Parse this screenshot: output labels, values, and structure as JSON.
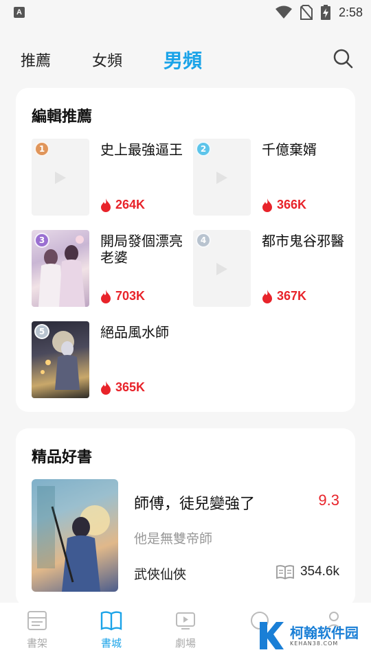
{
  "status_bar": {
    "time": "2:58",
    "notification_icon_letter": "A"
  },
  "tabs": [
    {
      "label": "推薦",
      "active": false
    },
    {
      "label": "女頻",
      "active": false
    },
    {
      "label": "男頻",
      "active": true
    }
  ],
  "editor_section": {
    "title": "編輯推薦",
    "items": [
      {
        "rank": "1",
        "title": "史上最強逼王",
        "heat": "264K",
        "medal_color": "#e0955a"
      },
      {
        "rank": "2",
        "title": "千億棄婿",
        "heat": "366K",
        "medal_color": "#5cc4ea"
      },
      {
        "rank": "3",
        "title": "開局發個漂亮老婆",
        "heat": "703K",
        "medal_color": "#9a6fd1"
      },
      {
        "rank": "4",
        "title": "都市鬼谷邪醫",
        "heat": "367K",
        "medal_color": "#b8c3cf"
      },
      {
        "rank": "5",
        "title": "絕品風水師",
        "heat": "365K",
        "medal_color": "#b8c3cf"
      }
    ]
  },
  "premium_section": {
    "title": "精品好書",
    "book": {
      "title": "師傅，徒兒變強了",
      "score": "9.3",
      "description": "他是無雙帝師",
      "genre": "武俠仙俠",
      "reads": "354.6k"
    }
  },
  "bottom_nav": [
    {
      "label": "書架",
      "icon": "bookshelf-icon",
      "active": false
    },
    {
      "label": "書城",
      "icon": "open-book-icon",
      "active": true
    },
    {
      "label": "劇場",
      "icon": "video-play-icon",
      "active": false
    },
    {
      "label": "",
      "icon": "circle-icon",
      "active": false
    },
    {
      "label": "",
      "icon": "user-icon",
      "active": false
    }
  ],
  "watermark": {
    "main": "柯翰软件园",
    "sub": "KEHAN38.COM"
  },
  "colors": {
    "accent": "#1aa3e8",
    "heat": "#e8232a",
    "card": "#ffffff",
    "background": "#f6f6f6"
  }
}
